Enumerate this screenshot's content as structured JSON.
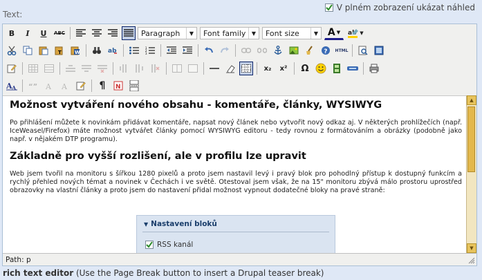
{
  "field_label": "Text:",
  "fullscreen_preview": {
    "label": "V plném zobrazení ukázat náhled",
    "checked": true
  },
  "toolbar": {
    "format_select": "Paragraph",
    "font_family_select": "Font family",
    "font_size_select": "Font size",
    "bold": "B",
    "italic": "I",
    "underline": "U",
    "strike": "ABC",
    "html_label": "HTML",
    "subscript": "x₂",
    "superscript": "x²",
    "omega": "Ω",
    "font_color": "A"
  },
  "content": {
    "heading1": "Možnost vytváření nového obsahu - komentáře, články, WYSIWYG",
    "para1": "Po přihlášení můžete k novinkám přidávat komentáře, napsat nový článek nebo vytvořit nový odkaz aj. V některých prohlížečích (např. IceWeasel/Firefox) máte možnost vytvářet články pomocí WYSIWYG editoru - tedy rovnou z formátováním a obrázky (podobně jako např. v nějakém DTP programu).",
    "heading2": "Základně pro vyšší rozlišení, ale v profilu lze upravit",
    "para2": "Web jsem tvořil na monitoru s šířkou 1280 pixelů a proto jsem nastavil levý i pravý blok pro pohodlný přístup k dostupný funkcím a rychlý přehled nových témat a novinek v Čechách i ve světě. Otestoval jsem však, že na 15\" monitoru zbývá málo prostoru uprostřed obrazovky na vlastní články a proto jsem do nastavení přidal možnost vypnout dodatečné bloky na pravé straně:",
    "embed_title": "Nastavení bloků",
    "embed_item": "RSS kanál"
  },
  "status_path": "Path: p",
  "footer": {
    "bold": "rich text editor",
    "rest": "(Use the Page Break button to insert a Drupal teaser break)"
  },
  "colors": {
    "background": "#dfe8f6",
    "toolbar": "#f0f0ee",
    "scrollbar": "#e8c45d",
    "embed": "#dae4f1"
  }
}
